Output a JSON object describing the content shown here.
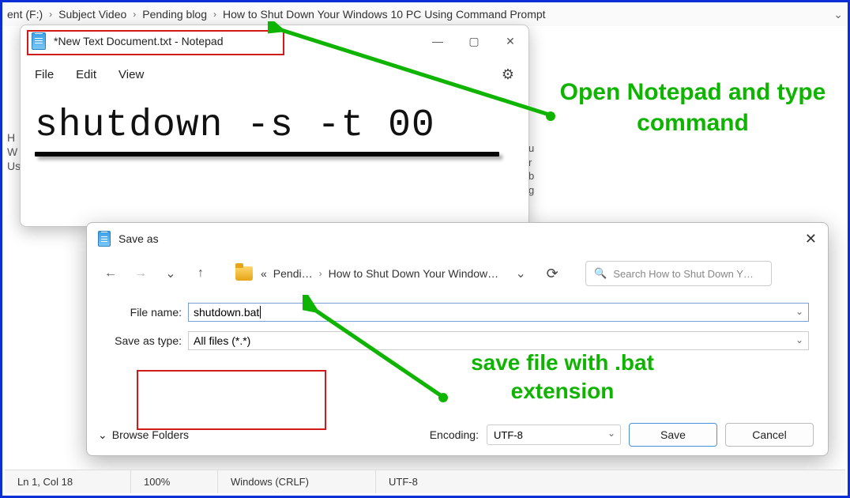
{
  "breadcrumb": {
    "items": [
      "ent (F:)",
      "Subject Video",
      "Pending blog",
      "How to Shut Down Your Windows 10 PC Using Command Prompt"
    ]
  },
  "notepad": {
    "title": "*New Text Document.txt - Notepad",
    "menus": {
      "file": "File",
      "edit": "Edit",
      "view": "View"
    },
    "command": "shutdown -s -t 00"
  },
  "annotations": {
    "a1": "Open Notepad and type command",
    "a2": "save file with .bat extension"
  },
  "bg": {
    "letters": "H\nW\nUsi",
    "snip": "u\nr\nb\ng"
  },
  "saveas": {
    "title": "Save as",
    "path": {
      "prefix": "«",
      "seg1": "Pendi…",
      "seg2": "How to Shut Down Your Window…"
    },
    "search_placeholder": "Search How to Shut Down Y…",
    "filename_label": "File name:",
    "filename_value": "shutdown.bat",
    "type_label": "Save as type:",
    "type_value": "All files  (*.*)",
    "browse": "Browse Folders",
    "encoding_label": "Encoding:",
    "encoding_value": "UTF-8",
    "save": "Save",
    "cancel": "Cancel"
  },
  "statusbar": {
    "pos": "Ln 1, Col 18",
    "zoom": "100%",
    "eol": "Windows (CRLF)",
    "encoding": "UTF-8"
  }
}
